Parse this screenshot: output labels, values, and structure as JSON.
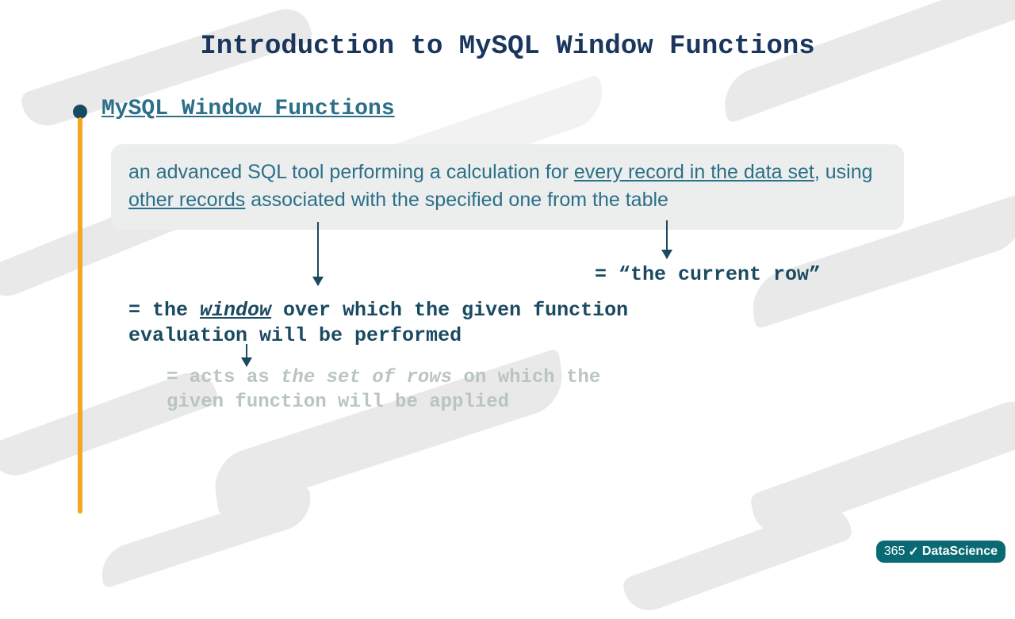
{
  "title": "Introduction to MySQL Window Functions",
  "section_heading": "MySQL Window Functions",
  "definition": {
    "pre1": "an advanced SQL tool performing a calculation for ",
    "u1": "every record in the data set",
    "mid1": ", using ",
    "u2": "other records",
    "post1": " associated with the specified one from the table"
  },
  "annot_right": "= “the current row”",
  "annot_left": {
    "pre": "= the ",
    "window": "window",
    "post_line1": " over which the given function",
    "line2": "evaluation will be performed"
  },
  "annot_faded": {
    "pre": "= acts as ",
    "italic": "the set of rows",
    "post_line1": " on which the",
    "line2": "given function will be applied"
  },
  "logo": {
    "num": "365",
    "check": "✓",
    "brand": "DataScience"
  }
}
